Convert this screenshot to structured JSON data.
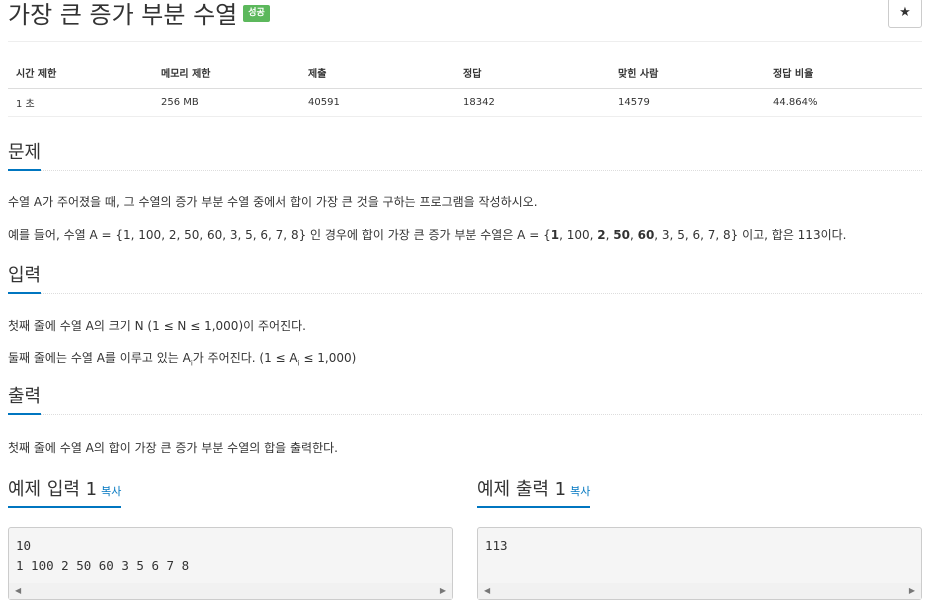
{
  "header": {
    "title": "가장 큰 증가 부분 수열",
    "badge": "성공",
    "star": "★"
  },
  "info_table": {
    "headers": [
      "시간 제한",
      "메모리 제한",
      "제출",
      "정답",
      "맞힌 사람",
      "정답 비율"
    ],
    "values": [
      "1 초",
      "256 MB",
      "40591",
      "18342",
      "14579",
      "44.864%"
    ]
  },
  "problem": {
    "heading": "문제",
    "p1": "수열 A가 주어졌을 때, 그 수열의 증가 부분 수열 중에서 합이 가장 큰 것을 구하는 프로그램을 작성하시오.",
    "p2_parts": [
      "예를 들어, 수열 A = {1, 100, 2, 50, 60, 3, 5, 6, 7, 8} 인 경우에 합이 가장 큰 증가 부분 수열은 A = {",
      "1",
      ", 100, ",
      "2",
      ", ",
      "50",
      ", ",
      "60",
      ", 3, 5, 6, 7, 8} 이고, 합은 113이다."
    ]
  },
  "input": {
    "heading": "입력",
    "p1": "첫째 줄에 수열 A의 크기 N (1 ≤ N ≤ 1,000)이 주어진다.",
    "p2_pre": "둘째 줄에는 수열 A를 이루고 있는 A",
    "p2_sub1": "i",
    "p2_mid": "가 주어진다. (1 ≤ A",
    "p2_sub2": "i",
    "p2_post": " ≤ 1,000)"
  },
  "output": {
    "heading": "출력",
    "p1": "첫째 줄에 수열 A의 합이 가장 큰 증가 부분 수열의 합을 출력한다."
  },
  "sample_input": {
    "heading": "예제 입력 1",
    "copy": "복사",
    "content": "10\n1 100 2 50 60 3 5 6 7 8"
  },
  "sample_output": {
    "heading": "예제 출력 1",
    "copy": "복사",
    "content": "113"
  }
}
